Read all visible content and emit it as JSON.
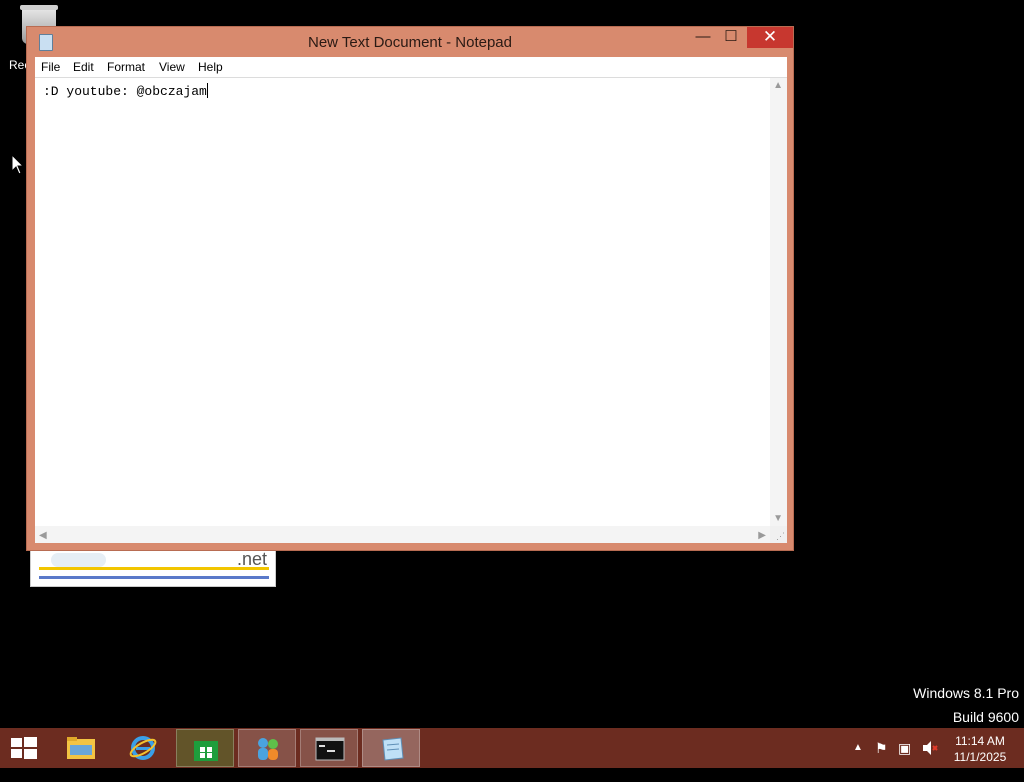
{
  "desktop": {
    "recycle_bin_label": "Rec",
    "background_window_logo": ".net"
  },
  "window": {
    "title": "New Text Document - Notepad",
    "menu": [
      "File",
      "Edit",
      "Format",
      "View",
      "Help"
    ],
    "content": ":D youtube: @obczajam",
    "minimize_glyph": "—",
    "maximize_glyph": "☐",
    "close_glyph": "✕"
  },
  "watermark": {
    "line1": "Windows 8.1 Pro",
    "line2": "Build 9600"
  },
  "taskbar": {
    "apps": [
      "file-explorer",
      "internet-explorer",
      "store",
      "windows-live-messenger",
      "command-prompt",
      "notepad"
    ],
    "active_app": "notepad",
    "clock_time": "11:14 AM",
    "clock_date": "11/1/2025"
  },
  "colors": {
    "window_frame": "#d88a6e",
    "taskbar": "#6c2c20",
    "close_button": "#c7372f"
  }
}
